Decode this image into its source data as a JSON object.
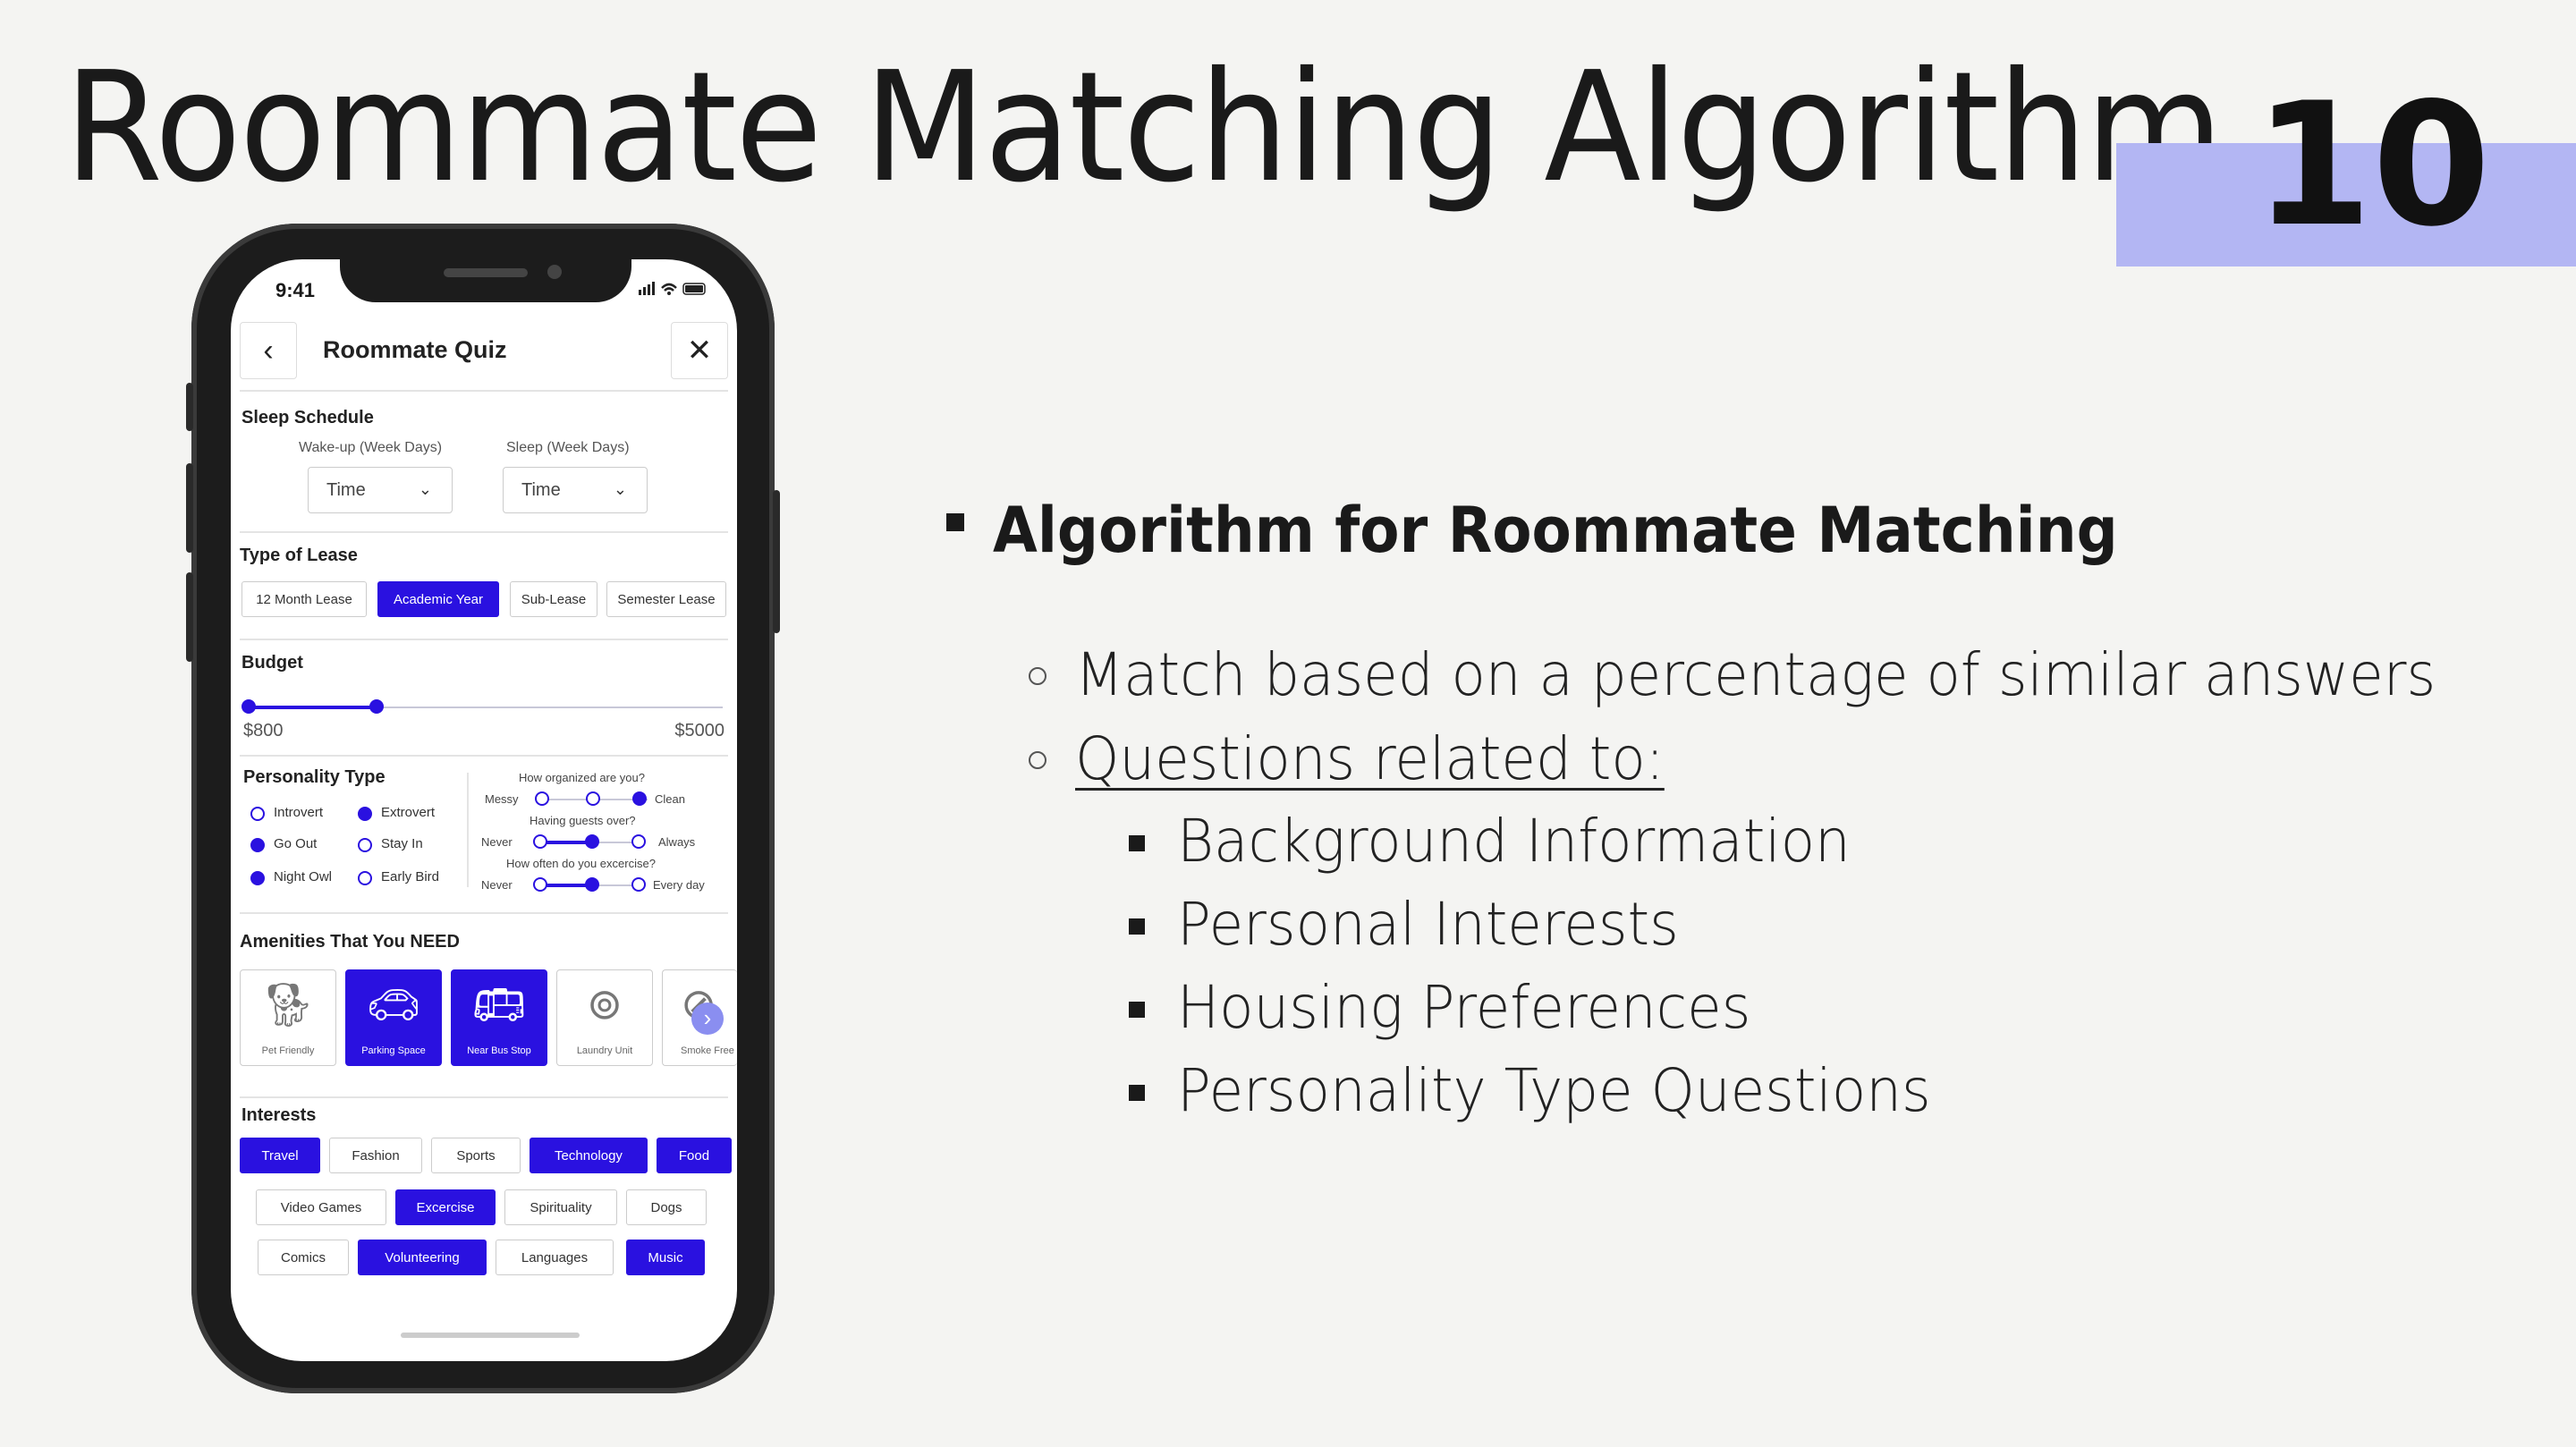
{
  "slide": {
    "title": "Roommate Matching Algorithm",
    "page_number": "10",
    "accent_color": "#b3b6f3"
  },
  "phone": {
    "status_time": "9:41",
    "header": {
      "title": "Roommate Quiz",
      "back_icon": "chevron-left-icon",
      "close_icon": "close-icon"
    },
    "sleep": {
      "section": "Sleep Schedule",
      "wake_label": "Wake-up (Week Days)",
      "sleep_label": "Sleep (Week Days)",
      "wake_value": "Time",
      "sleep_value": "Time"
    },
    "lease": {
      "section": "Type of Lease",
      "options": [
        "12 Month Lease",
        "Academic Year",
        "Sub-Lease",
        "Semester Lease"
      ],
      "selected": "Academic Year"
    },
    "budget": {
      "section": "Budget",
      "min_label": "$800",
      "max_label": "$5000",
      "selected_fraction": 0.27
    },
    "personality": {
      "section": "Personality Type",
      "radios": [
        {
          "label": "Introvert",
          "on": false
        },
        {
          "label": "Extrovert",
          "on": true
        },
        {
          "label": "Go Out",
          "on": true
        },
        {
          "label": "Stay In",
          "on": false
        },
        {
          "label": "Night Owl",
          "on": true
        },
        {
          "label": "Early Bird",
          "on": false
        }
      ],
      "q1": "How organized are you?",
      "q1_left": "Messy",
      "q1_right": "Clean",
      "q2": "Having guests over?",
      "q2_left": "Never",
      "q2_right": "Always",
      "q3": "How often do you excercise?",
      "q3_left": "Never",
      "q3_right": "Every day"
    },
    "amenities": {
      "section": "Amenities That You NEED",
      "items": [
        {
          "label": "Pet Friendly",
          "icon": "pet-icon",
          "on": false
        },
        {
          "label": "Parking Space",
          "icon": "car-icon",
          "on": true
        },
        {
          "label": "Near Bus Stop",
          "icon": "bus-icon",
          "on": true
        },
        {
          "label": "Laundry Unit",
          "icon": "laundry-icon",
          "on": false
        },
        {
          "label": "Smoke Free",
          "icon": "no-smoking-icon",
          "on": false
        }
      ]
    },
    "interests": {
      "section": "Interests",
      "row1": [
        {
          "label": "Travel",
          "on": true
        },
        {
          "label": "Fashion",
          "on": false
        },
        {
          "label": "Sports",
          "on": false
        },
        {
          "label": "Technology",
          "on": true
        },
        {
          "label": "Food",
          "on": true
        }
      ],
      "row2": [
        {
          "label": "Video Games",
          "on": false
        },
        {
          "label": "Excercise",
          "on": true
        },
        {
          "label": "Spirituality",
          "on": false
        },
        {
          "label": "Dogs",
          "on": false
        }
      ],
      "row3": [
        {
          "label": "Comics",
          "on": false
        },
        {
          "label": "Volunteering",
          "on": true
        },
        {
          "label": "Languages",
          "on": false
        },
        {
          "label": "Music",
          "on": true
        }
      ]
    },
    "accent_color": "#2a11e0"
  },
  "content": {
    "heading": "Algorithm for Roommate Matching",
    "points": [
      "Match based on a percentage of similar answers",
      "Questions related to: "
    ],
    "subpoints": [
      "Background Information",
      "Personal Interests",
      "Housing Preferences",
      "Personality Type Questions"
    ]
  }
}
